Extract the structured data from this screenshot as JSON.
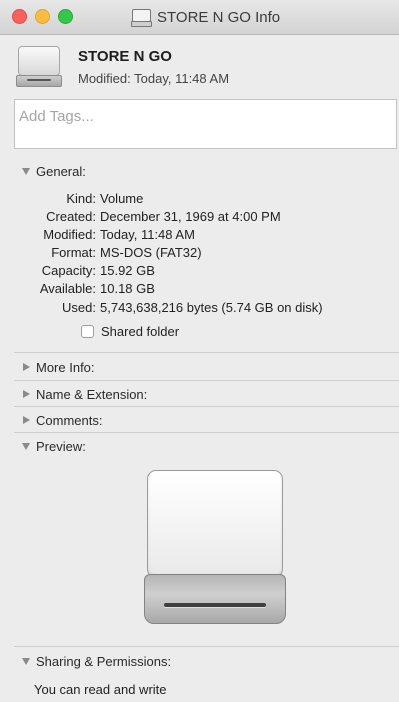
{
  "window": {
    "title": "STORE N GO Info",
    "icon": "drive-icon"
  },
  "header": {
    "name": "STORE N GO",
    "modified": "Modified: Today, 11:48 AM"
  },
  "tags": {
    "placeholder": "Add Tags..."
  },
  "general": {
    "label": "General:",
    "rows": [
      {
        "key": "Kind:",
        "value": "Volume"
      },
      {
        "key": "Created:",
        "value": "December 31, 1969 at 4:00 PM"
      },
      {
        "key": "Modified:",
        "value": "Today, 11:48 AM"
      },
      {
        "key": "Format:",
        "value": "MS-DOS (FAT32)"
      },
      {
        "key": "Capacity:",
        "value": "15.92 GB"
      },
      {
        "key": "Available:",
        "value": "10.18 GB"
      },
      {
        "key": "Used:",
        "value": "5,743,638,216 bytes (5.74 GB on disk)"
      }
    ],
    "shared_folder": "Shared folder"
  },
  "sections": {
    "more_info": "More Info:",
    "name_extension": "Name & Extension:",
    "comments": "Comments:",
    "preview": "Preview:",
    "sharing": "Sharing & Permissions:"
  },
  "permissions": {
    "text": "You can read and write"
  }
}
